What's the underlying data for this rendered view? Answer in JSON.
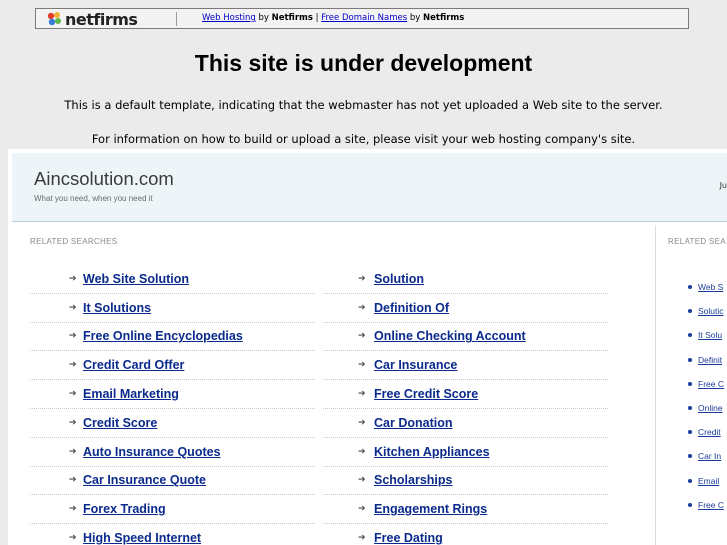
{
  "banner": {
    "logo_text": "netfirms",
    "link1": "Web Hosting",
    "by1": "by",
    "brand1": "Netfirms",
    "sep": "|",
    "link2": "Free Domain Names",
    "by2": "by",
    "brand2": "Netfirms"
  },
  "headline": "This site is under development",
  "line1": "This is a default template, indicating that the webmaster has not yet uploaded a Web site to the server.",
  "line2": "For information on how to build or upload a site, please visit your web hosting company's site.",
  "parked": {
    "site_name": "Aincsolution.com",
    "tagline": "What you need, when you need it",
    "corner_text": "Ju",
    "related_heading": "RELATED SEARCHES",
    "side_heading": "RELATED SEA",
    "left_links": [
      "Web Site Solution",
      "It Solutions",
      "Free Online Encyclopedias",
      "Credit Card Offer",
      "Email Marketing",
      "Credit Score",
      "Auto Insurance Quotes",
      "Car Insurance Quote",
      "Forex Trading",
      "High Speed Internet"
    ],
    "right_links": [
      "Solution",
      "Definition Of",
      "Online Checking Account",
      "Car Insurance",
      "Free Credit Score",
      "Car Donation",
      "Kitchen Appliances",
      "Scholarships",
      "Engagement Rings",
      "Free Dating"
    ],
    "side_links": [
      "Web S",
      "Solutic",
      "It Solu",
      "Definit",
      "Free C",
      "Online",
      "Credit",
      "Car In",
      "Email",
      "Free C"
    ]
  },
  "colors": {
    "link": "#0a2a8c",
    "side_link": "#1a3c9a",
    "header_bg": "#eef5f9",
    "page_bg": "#ebebeb"
  }
}
